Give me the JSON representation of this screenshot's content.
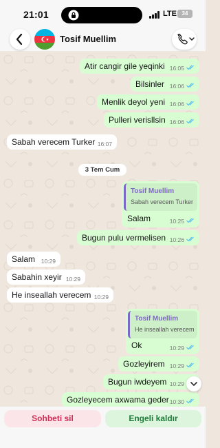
{
  "status_bar": {
    "time": "21:01",
    "network": "LTE",
    "battery": "34"
  },
  "header": {
    "contact_name": "Tosif Muellim"
  },
  "colors": {
    "outgoing": "#d9fdd3",
    "incoming": "#ffffff",
    "tick_read": "#53bdeb",
    "quote_accent": "#7f66c9",
    "delete": "#cf2e56",
    "unblock": "#1e7a3a"
  },
  "messages": [
    {
      "text": "Atir cangir gile yeqinki",
      "time": "16:05",
      "dir": "out"
    },
    {
      "text": "Bilsinler",
      "time": "16:06",
      "dir": "out"
    },
    {
      "text": "Menlik deyol yeni",
      "time": "16:06",
      "dir": "out"
    },
    {
      "text": "Pulleri verisllsin",
      "time": "16:06",
      "dir": "out"
    },
    {
      "text": "Sabah verecem Turker",
      "time": "16:07",
      "dir": "in"
    },
    {
      "quote_name": "Tosif Muellim",
      "quote_text": "Sabah verecem Turker",
      "text": "Salam",
      "time": "10:25",
      "dir": "out"
    },
    {
      "text": "Bugun pulu vermelisen",
      "time": "10:26",
      "dir": "out"
    },
    {
      "text": "Salam",
      "time": "10:29",
      "dir": "in"
    },
    {
      "text": "Sabahin xeyir",
      "time": "10:29",
      "dir": "in"
    },
    {
      "text": "He inseallah verecem",
      "time": "10:29",
      "dir": "in"
    },
    {
      "quote_name": "Tosif Muellim",
      "quote_text": "He inseallah verecem",
      "text": "Ok",
      "time": "10:29",
      "dir": "out"
    },
    {
      "text": "Gozleyirem",
      "time": "10:29",
      "dir": "out"
    },
    {
      "text": "Bugun iwdeyem",
      "time": "10:29",
      "dir": "out"
    },
    {
      "text": "Gozleyecem axwama geder",
      "time": "10:30",
      "dir": "out"
    }
  ],
  "date_divider": "3 Tem Cum",
  "actions": {
    "delete_chat": "Sohbeti sil",
    "unblock": "Engeli kaldır"
  }
}
